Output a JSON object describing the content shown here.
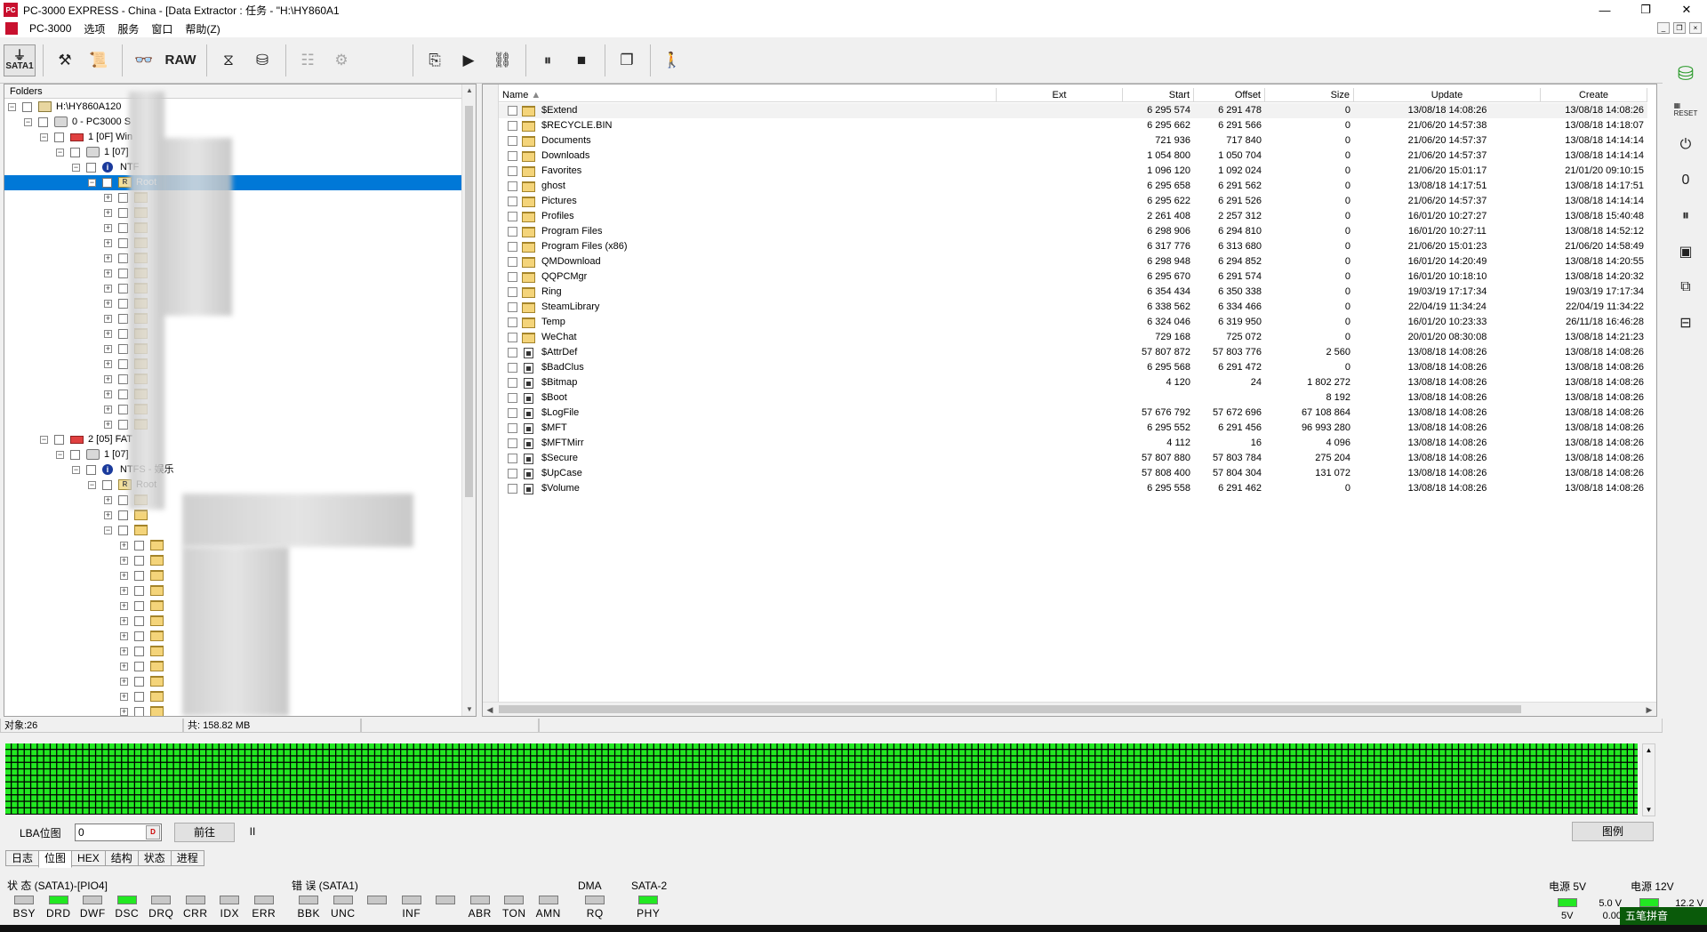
{
  "window": {
    "title": "PC-3000 EXPRESS - China - [Data Extractor : 任务 - \"H:\\HY860A1",
    "minimize": "—",
    "maximize": "❐",
    "close": "✕"
  },
  "menu": [
    "PC-3000",
    "选项",
    "服务",
    "窗口",
    "帮助(Z)"
  ],
  "toolbar": {
    "sata_label": "SATA1",
    "raw_label": "RAW"
  },
  "tree": {
    "header": "Folders",
    "nodes": [
      {
        "label": "H:\\HY860A120",
        "indent": 0
      },
      {
        "label": "0 - PC3000 S",
        "indent": 1
      },
      {
        "label": "1 [0F] Win",
        "indent": 2
      },
      {
        "label": "1 [07]",
        "indent": 3
      },
      {
        "label": "NTF",
        "indent": 4
      },
      {
        "label": "Root",
        "indent": 5
      },
      {
        "label": "2 [05] FAT",
        "indent": 2
      },
      {
        "label": "1 [07]",
        "indent": 3
      },
      {
        "label": "NTFS - 娱乐",
        "indent": 4
      },
      {
        "label": "Root",
        "indent": 5
      }
    ]
  },
  "list": {
    "columns": {
      "name": "Name",
      "ext": "Ext",
      "start": "Start",
      "offset": "Offset",
      "size": "Size",
      "update": "Update",
      "create": "Create"
    },
    "rows": [
      {
        "name": "$Extend",
        "type": "folder",
        "start": "6 295 574",
        "offset": "6 291 478",
        "size": "0",
        "update": "13/08/18 14:08:26",
        "create": "13/08/18 14:08:26"
      },
      {
        "name": "$RECYCLE.BIN",
        "type": "folder",
        "start": "6 295 662",
        "offset": "6 291 566",
        "size": "0",
        "update": "21/06/20 14:57:38",
        "create": "13/08/18 14:18:07"
      },
      {
        "name": "Documents",
        "type": "folder",
        "start": "721 936",
        "offset": "717 840",
        "size": "0",
        "update": "21/06/20 14:57:37",
        "create": "13/08/18 14:14:14"
      },
      {
        "name": "Downloads",
        "type": "folder",
        "start": "1 054 800",
        "offset": "1 050 704",
        "size": "0",
        "update": "21/06/20 14:57:37",
        "create": "13/08/18 14:14:14"
      },
      {
        "name": "Favorites",
        "type": "folder",
        "start": "1 096 120",
        "offset": "1 092 024",
        "size": "0",
        "update": "21/06/20 15:01:17",
        "create": "21/01/20 09:10:15"
      },
      {
        "name": "ghost",
        "type": "folder",
        "start": "6 295 658",
        "offset": "6 291 562",
        "size": "0",
        "update": "13/08/18 14:17:51",
        "create": "13/08/18 14:17:51"
      },
      {
        "name": "Pictures",
        "type": "folder",
        "start": "6 295 622",
        "offset": "6 291 526",
        "size": "0",
        "update": "21/06/20 14:57:37",
        "create": "13/08/18 14:14:14"
      },
      {
        "name": "Profiles",
        "type": "folder",
        "start": "2 261 408",
        "offset": "2 257 312",
        "size": "0",
        "update": "16/01/20 10:27:27",
        "create": "13/08/18 15:40:48"
      },
      {
        "name": "Program Files",
        "type": "folder",
        "start": "6 298 906",
        "offset": "6 294 810",
        "size": "0",
        "update": "16/01/20 10:27:11",
        "create": "13/08/18 14:52:12"
      },
      {
        "name": "Program Files (x86)",
        "type": "folder",
        "start": "6 317 776",
        "offset": "6 313 680",
        "size": "0",
        "update": "21/06/20 15:01:23",
        "create": "21/06/20 14:58:49"
      },
      {
        "name": "QMDownload",
        "type": "folder",
        "start": "6 298 948",
        "offset": "6 294 852",
        "size": "0",
        "update": "16/01/20 14:20:49",
        "create": "13/08/18 14:20:55"
      },
      {
        "name": "QQPCMgr",
        "type": "folder",
        "start": "6 295 670",
        "offset": "6 291 574",
        "size": "0",
        "update": "16/01/20 10:18:10",
        "create": "13/08/18 14:20:32"
      },
      {
        "name": "Ring",
        "type": "folder",
        "start": "6 354 434",
        "offset": "6 350 338",
        "size": "0",
        "update": "19/03/19 17:17:34",
        "create": "19/03/19 17:17:34"
      },
      {
        "name": "SteamLibrary",
        "type": "folder",
        "start": "6 338 562",
        "offset": "6 334 466",
        "size": "0",
        "update": "22/04/19 11:34:24",
        "create": "22/04/19 11:34:22"
      },
      {
        "name": "Temp",
        "type": "folder",
        "start": "6 324 046",
        "offset": "6 319 950",
        "size": "0",
        "update": "16/01/20 10:23:33",
        "create": "26/11/18 16:46:28"
      },
      {
        "name": "WeChat",
        "type": "folder",
        "start": "729 168",
        "offset": "725 072",
        "size": "0",
        "update": "20/01/20 08:30:08",
        "create": "13/08/18 14:21:23"
      },
      {
        "name": "$AttrDef",
        "type": "file",
        "start": "57 807 872",
        "offset": "57 803 776",
        "size": "2 560",
        "update": "13/08/18 14:08:26",
        "create": "13/08/18 14:08:26"
      },
      {
        "name": "$BadClus",
        "type": "file",
        "start": "6 295 568",
        "offset": "6 291 472",
        "size": "0",
        "update": "13/08/18 14:08:26",
        "create": "13/08/18 14:08:26"
      },
      {
        "name": "$Bitmap",
        "type": "file",
        "start": "4 120",
        "offset": "24",
        "size": "1 802 272",
        "update": "13/08/18 14:08:26",
        "create": "13/08/18 14:08:26"
      },
      {
        "name": "$Boot",
        "type": "file",
        "start": "",
        "offset": "",
        "size": "8 192",
        "update": "13/08/18 14:08:26",
        "create": "13/08/18 14:08:26"
      },
      {
        "name": "$LogFile",
        "type": "file",
        "start": "57 676 792",
        "offset": "57 672 696",
        "size": "67 108 864",
        "update": "13/08/18 14:08:26",
        "create": "13/08/18 14:08:26"
      },
      {
        "name": "$MFT",
        "type": "file",
        "start": "6 295 552",
        "offset": "6 291 456",
        "size": "96 993 280",
        "update": "13/08/18 14:08:26",
        "create": "13/08/18 14:08:26"
      },
      {
        "name": "$MFTMirr",
        "type": "file",
        "start": "4 112",
        "offset": "16",
        "size": "4 096",
        "update": "13/08/18 14:08:26",
        "create": "13/08/18 14:08:26"
      },
      {
        "name": "$Secure",
        "type": "file",
        "start": "57 807 880",
        "offset": "57 803 784",
        "size": "275 204",
        "update": "13/08/18 14:08:26",
        "create": "13/08/18 14:08:26"
      },
      {
        "name": "$UpCase",
        "type": "file",
        "start": "57 808 400",
        "offset": "57 804 304",
        "size": "131 072",
        "update": "13/08/18 14:08:26",
        "create": "13/08/18 14:08:26"
      },
      {
        "name": "$Volume",
        "type": "file",
        "start": "6 295 558",
        "offset": "6 291 462",
        "size": "0",
        "update": "13/08/18 14:08:26",
        "create": "13/08/18 14:08:26"
      }
    ]
  },
  "status": {
    "objects": "对象:26",
    "total": "共: 1​5​8.82 MB"
  },
  "lba": {
    "label": "LBA位图",
    "value": "0",
    "dec_label": "D",
    "goto": "前往",
    "pause": "II",
    "legend": "图例",
    "map_color": "#22e822"
  },
  "tabs": [
    "日志",
    "位图",
    "HEX",
    "结构",
    "状态",
    "进程"
  ],
  "indicators": {
    "status_title": "状 态 (SATA1)-[PIO4]",
    "status_leds": [
      {
        "name": "BSY",
        "on": false
      },
      {
        "name": "DRD",
        "on": true
      },
      {
        "name": "DWF",
        "on": false
      },
      {
        "name": "DSC",
        "on": true
      },
      {
        "name": "DRQ",
        "on": false
      },
      {
        "name": "CRR",
        "on": false
      },
      {
        "name": "IDX",
        "on": false
      },
      {
        "name": "ERR",
        "on": false
      }
    ],
    "error_title": "错 误 (SATA1)",
    "error_leds": [
      {
        "name": "BBK",
        "on": false
      },
      {
        "name": "UNC",
        "on": false
      },
      {
        "name": "",
        "on": false
      },
      {
        "name": "INF",
        "on": false
      },
      {
        "name": "",
        "on": false
      },
      {
        "name": "ABR",
        "on": false
      },
      {
        "name": "TON",
        "on": false
      },
      {
        "name": "AMN",
        "on": false
      }
    ],
    "dma_title": "DMA",
    "dma_leds": [
      {
        "name": "RQ",
        "on": false
      }
    ],
    "sata_title": "SATA-2",
    "sata_leds": [
      {
        "name": "PHY",
        "on": true
      }
    ],
    "power5_title": "电源 5V",
    "power5_label": "5V",
    "power5_v": "5.0 V",
    "power5_a": "0.00",
    "power12_title": "电源 12V",
    "power12_v": "12.2 V"
  },
  "ime": "五笔拼音"
}
